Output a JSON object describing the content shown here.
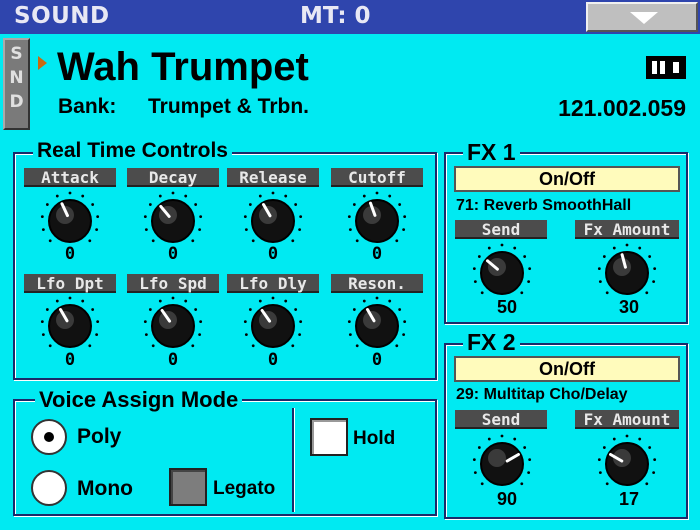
{
  "topbar": {
    "title": "SOUND",
    "mt": "MT: 0"
  },
  "sound": {
    "tab_letters": [
      "S",
      "N",
      "D"
    ],
    "name": "Wah Trumpet",
    "bank_label": "Bank:",
    "bank_name": "Trumpet & Trbn.",
    "program_number": "121.002.059"
  },
  "realtime": {
    "title": "Real Time Controls",
    "controls": [
      {
        "label": "Attack",
        "value": "0"
      },
      {
        "label": "Decay",
        "value": "0"
      },
      {
        "label": "Release",
        "value": "0"
      },
      {
        "label": "Cutoff",
        "value": "0"
      },
      {
        "label": "Lfo Dpt",
        "value": "0"
      },
      {
        "label": "Lfo Spd",
        "value": "0"
      },
      {
        "label": "Lfo Dly",
        "value": "0"
      },
      {
        "label": "Reson.",
        "value": "0"
      }
    ]
  },
  "fx1": {
    "title": "FX 1",
    "onoff": "On/Off",
    "effect": "71:  Reverb SmoothHall",
    "send_label": "Send",
    "amount_label": "Fx Amount",
    "send_value": "50",
    "amount_value": "30"
  },
  "fx2": {
    "title": "FX 2",
    "onoff": "On/Off",
    "effect": "29:  Multitap Cho/Delay",
    "send_label": "Send",
    "amount_label": "Fx Amount",
    "send_value": "90",
    "amount_value": "17"
  },
  "voice_assign": {
    "title": "Voice Assign Mode",
    "poly_label": "Poly",
    "mono_label": "Mono",
    "legato_label": "Legato",
    "hold_label": "Hold",
    "selected": "Poly"
  },
  "colors": {
    "background": "#00eaf2",
    "topbar": "#2f45ad",
    "label_bg": "#4c4c4c",
    "onoff_bg": "#fffbbc",
    "accent_arrow": "#c86a10"
  }
}
